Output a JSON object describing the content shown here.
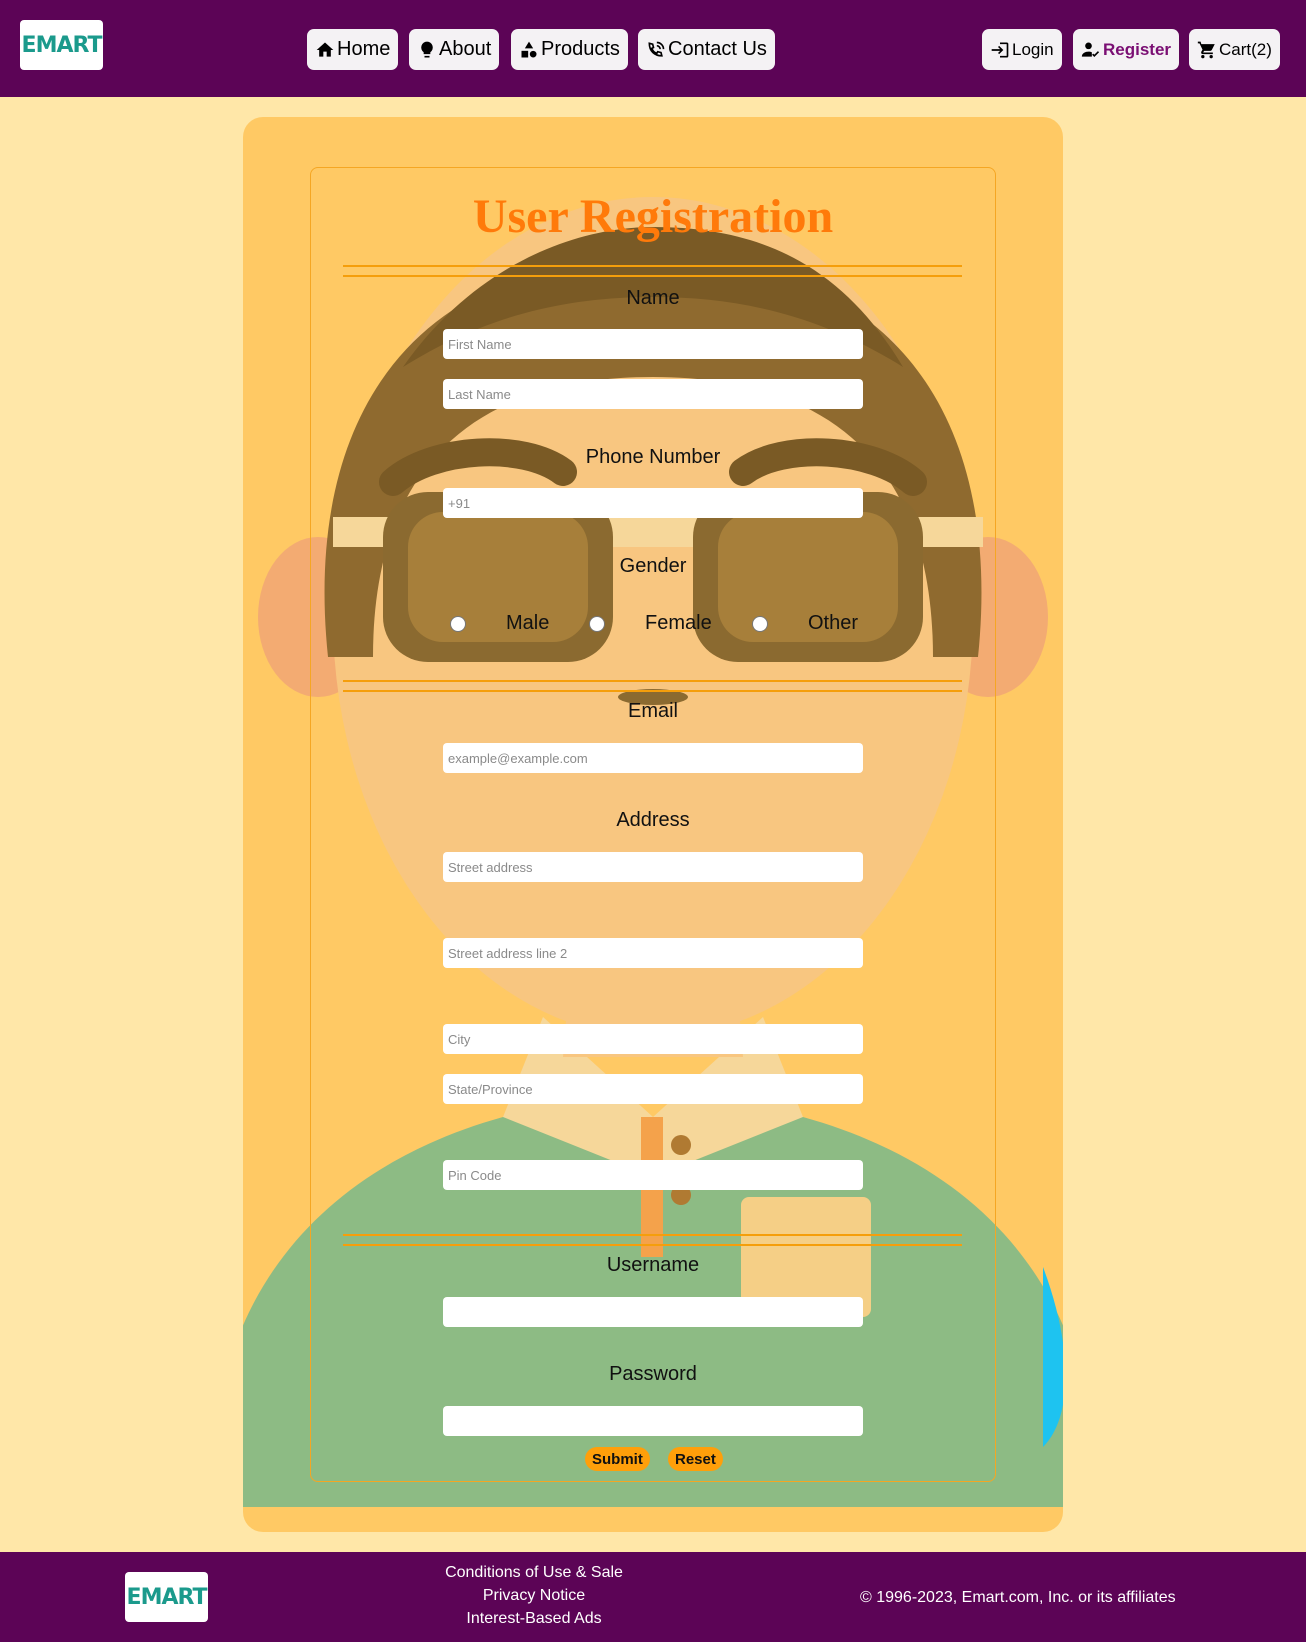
{
  "brand": {
    "logo": "EMART"
  },
  "nav": {
    "home": "Home",
    "about": "About",
    "products": "Products",
    "contact": "Contact Us",
    "login": "Login",
    "register": "Register",
    "cart": "Cart(2)"
  },
  "icons": {
    "home": "home-icon",
    "about": "lightbulb-icon",
    "products": "shapes-icon",
    "contact": "phone-call-icon",
    "login": "login-icon",
    "register": "user-check-icon",
    "cart": "cart-icon"
  },
  "form": {
    "title": "User Registration",
    "name_label": "Name",
    "first_name_ph": "First Name",
    "last_name_ph": "Last Name",
    "phone_label": "Phone Number",
    "phone_ph": "+91",
    "gender_label": "Gender",
    "gender_options": [
      "Male",
      "Female",
      "Other"
    ],
    "email_label": "Email",
    "email_ph": "example@example.com",
    "address_label": "Address",
    "street_ph": "Street address",
    "street2_ph": "Street address line 2",
    "city_ph": "City",
    "state_ph": "State/Province",
    "pin_ph": "Pin Code",
    "username_label": "Username",
    "password_label": "Password",
    "submit": "Submit",
    "reset": "Reset"
  },
  "footer": {
    "links": [
      "Conditions of Use & Sale",
      "Privacy Notice",
      "Interest-Based Ads"
    ],
    "copyright": "© 1996-2023, Emart.com, Inc. or its affiliates"
  },
  "colors": {
    "header_bg": "#5c0456",
    "page_bg": "#ffe7a8",
    "card_bg": "#ffc964",
    "title": "#ff7a0a",
    "accent": "#f59e0b"
  }
}
